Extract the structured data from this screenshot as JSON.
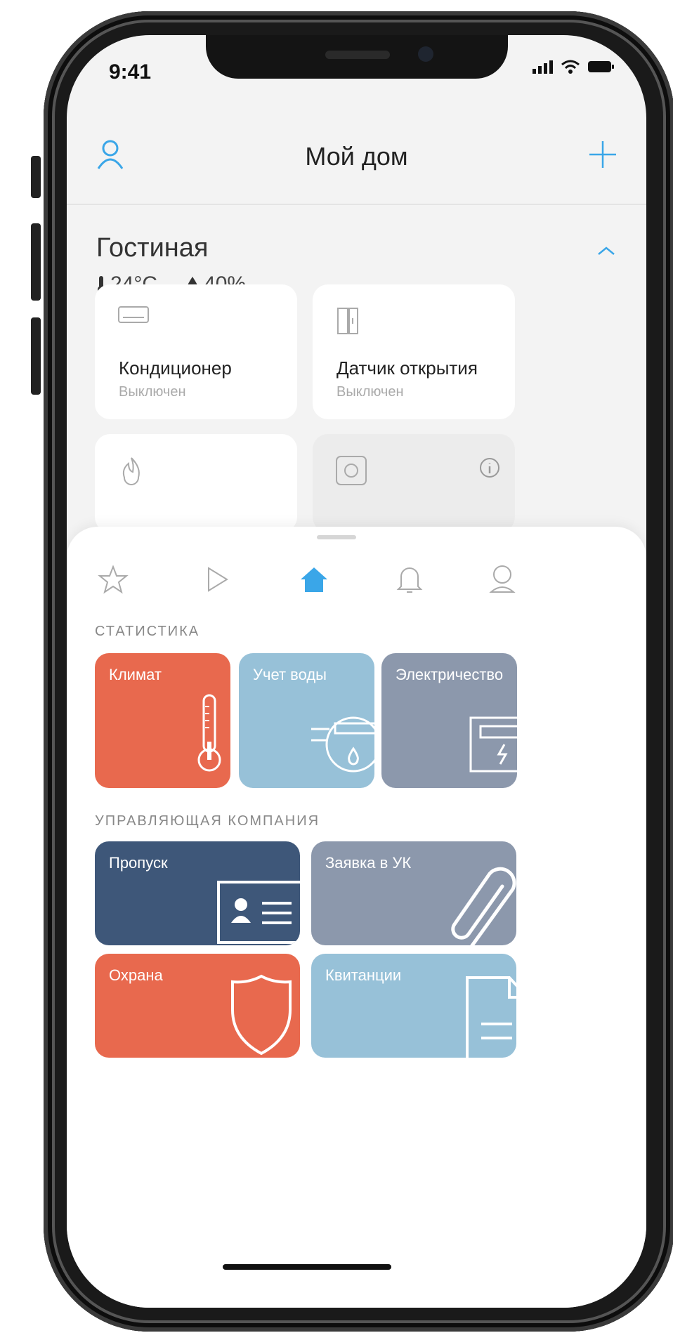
{
  "status_bar": {
    "time": "9:41"
  },
  "header": {
    "title": "Мой дом",
    "user_icon": "user-icon",
    "add_icon": "plus-icon"
  },
  "room": {
    "name": "Гостиная",
    "temperature": "24°C",
    "humidity": "40%"
  },
  "devices": [
    {
      "name": "Кондиционер",
      "state": "Выключен",
      "icon": "air-conditioner-icon"
    },
    {
      "name": "Датчик открытия",
      "state": "Выключен",
      "icon": "door-sensor-icon"
    },
    {
      "name": "",
      "state": "",
      "icon": "fire-sensor-icon"
    },
    {
      "name": "",
      "state": "",
      "icon": "power-socket-icon"
    }
  ],
  "tabs": [
    "star-icon",
    "play-icon",
    "home-icon",
    "bell-icon",
    "profile-icon"
  ],
  "active_tab": "home-icon",
  "statistics": {
    "title": "СТАТИСТИКА",
    "tiles": [
      {
        "label": "Климат",
        "color": "#E8694E"
      },
      {
        "label": "Учет воды",
        "color": "#97C1D8"
      },
      {
        "label": "Электричество",
        "color": "#8C98AC"
      }
    ]
  },
  "management": {
    "title": "УПРАВЛЯЮЩАЯ КОМПАНИЯ",
    "tiles": [
      {
        "label": "Пропуск",
        "color": "#3E5779"
      },
      {
        "label": "Заявка в УК",
        "color": "#8C98AC"
      },
      {
        "label": "Охрана",
        "color": "#E8694E"
      },
      {
        "label": "Квитанции",
        "color": "#97C1D8"
      }
    ]
  },
  "colors": {
    "accent": "#3AA6E8",
    "background": "#F3F3F3"
  }
}
